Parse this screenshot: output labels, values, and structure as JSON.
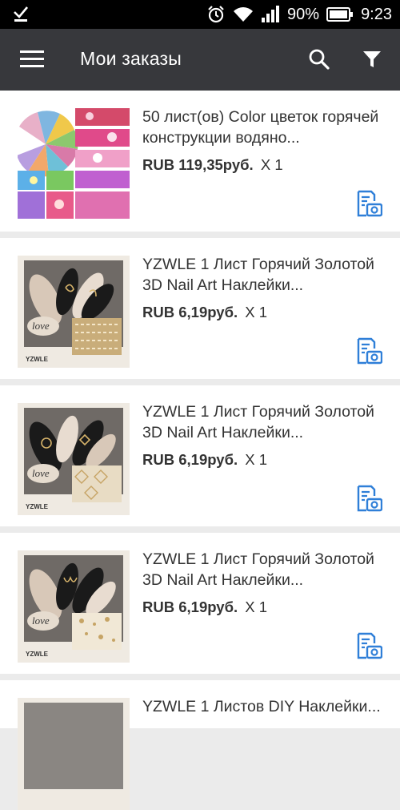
{
  "status_bar": {
    "battery": "90%",
    "time": "9:23"
  },
  "app_bar": {
    "title": "Мои заказы"
  },
  "orders": [
    {
      "name": "50 лист(ов) Color цветок горячей конструкции водяно...",
      "price": "RUB 119,35руб.",
      "qty": "X 1"
    },
    {
      "name": "YZWLE 1 Лист Горячий Золотой 3D Nail Art Наклейки...",
      "price": "RUB 6,19руб.",
      "qty": "X 1"
    },
    {
      "name": "YZWLE 1 Лист Горячий Золотой 3D Nail Art Наклейки...",
      "price": "RUB 6,19руб.",
      "qty": "X 1"
    },
    {
      "name": "YZWLE 1 Лист Горячий Золотой 3D Nail Art Наклейки...",
      "price": "RUB 6,19руб.",
      "qty": "X 1"
    },
    {
      "name": "YZWLE 1 Листов DIY Наклейки...",
      "price": "",
      "qty": ""
    }
  ],
  "thumb_labels": {
    "love": "love",
    "brand": "YZWLE"
  },
  "colors": {
    "app_bar": "#37383c",
    "accent_icon": "#2f7fd8",
    "background": "#ebebeb"
  }
}
